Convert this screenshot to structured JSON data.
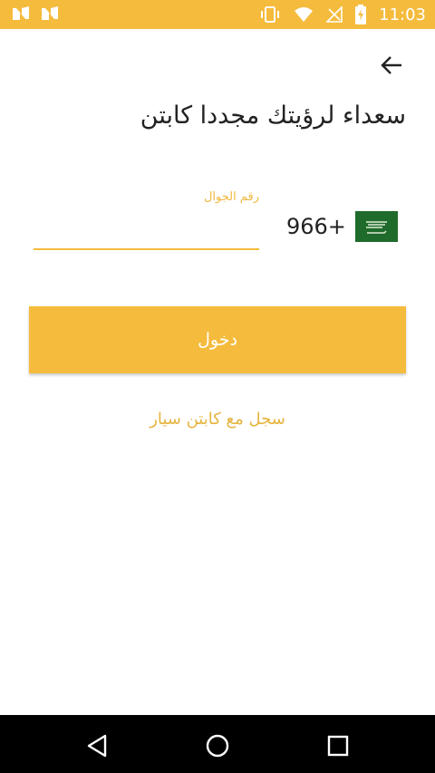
{
  "status_bar": {
    "time": "11:03",
    "icons": [
      "notification-n-icon",
      "notification-n-icon",
      "vibrate-icon",
      "wifi-icon",
      "no-signal-icon",
      "battery-charging-icon"
    ]
  },
  "colors": {
    "accent": "#f5bb3c",
    "nav_bar": "#000000"
  },
  "header": {
    "back_icon": "arrow-back-icon"
  },
  "title": "سعداء لرؤيتك مجددا كابتن",
  "phone": {
    "label": "رقم الجوال",
    "value": "",
    "country_code": "966+",
    "flag": "saudi-arabia-flag"
  },
  "login_button": "دخول",
  "register_link": "سجل مع كابتن سيار",
  "nav": {
    "back": "back-icon",
    "home": "home-icon",
    "recents": "recents-icon"
  }
}
